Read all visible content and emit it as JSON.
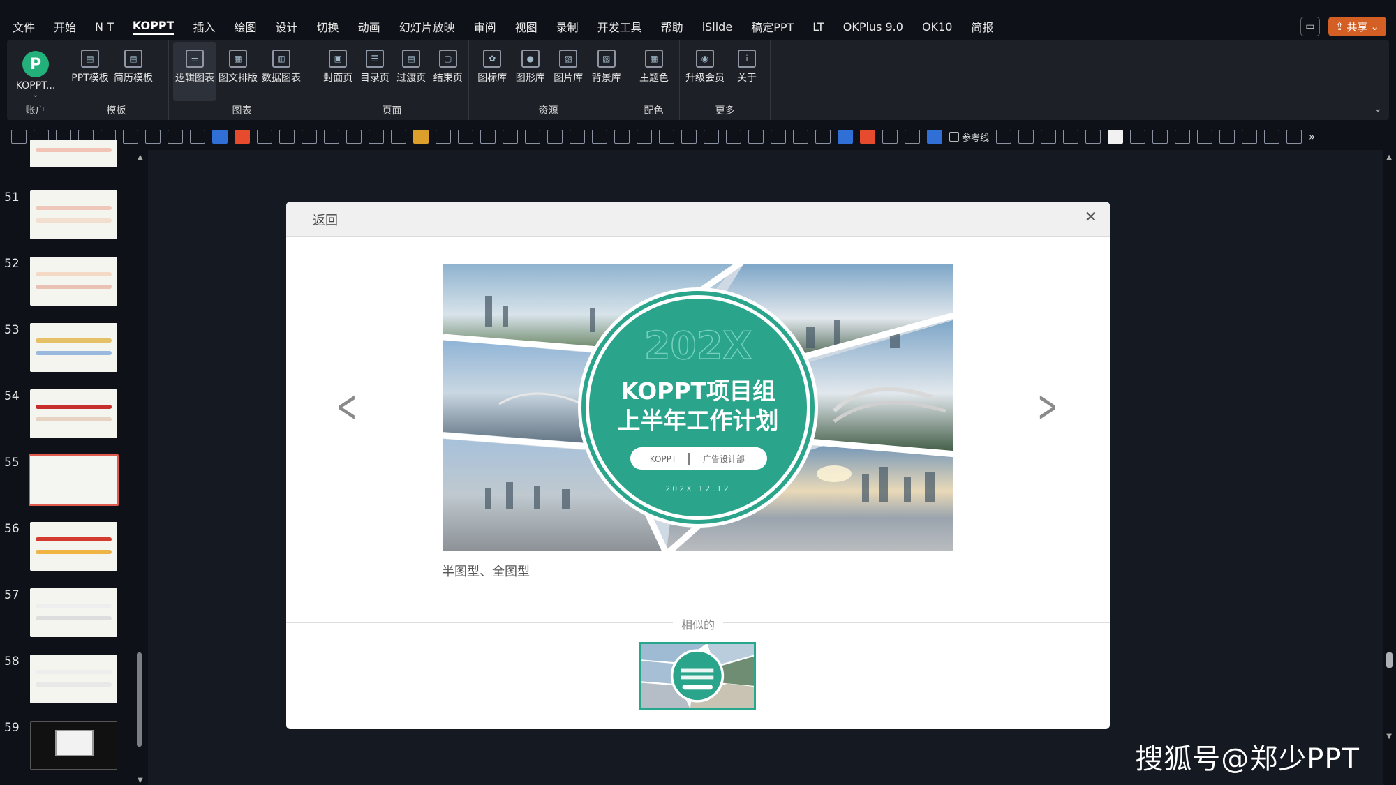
{
  "menu": {
    "items": [
      "文件",
      "开始",
      "N T",
      "KOPPT",
      "插入",
      "绘图",
      "设计",
      "切换",
      "动画",
      "幻灯片放映",
      "审阅",
      "视图",
      "录制",
      "开发工具",
      "帮助",
      "iSlide",
      "稿定PPT",
      "LT",
      "OKPlus 9.0",
      "OK10",
      "简报"
    ],
    "active": "KOPPT",
    "share_label": "共享"
  },
  "ribbon": {
    "account": {
      "button": "KOPPT...",
      "group": "账户"
    },
    "template": {
      "buttons": [
        "PPT模板",
        "简历模板"
      ],
      "group": "模板"
    },
    "chart": {
      "buttons": [
        "逻辑图表",
        "图文排版",
        "数据图表"
      ],
      "group": "图表"
    },
    "page": {
      "buttons": [
        "封面页",
        "目录页",
        "过渡页",
        "结束页"
      ],
      "group": "页面"
    },
    "resource": {
      "buttons": [
        "图标库",
        "图形库",
        "图片库",
        "背景库"
      ],
      "group": "资源"
    },
    "color": {
      "buttons": [
        "主题色"
      ],
      "group": "配色"
    },
    "more": {
      "buttons": [
        "升级会员",
        "关于"
      ],
      "group": "更多"
    }
  },
  "toolbar": {
    "guide_label": "参考线"
  },
  "slides": [
    {
      "num": "51"
    },
    {
      "num": "52"
    },
    {
      "num": "53"
    },
    {
      "num": "54"
    },
    {
      "num": "55",
      "selected": true
    },
    {
      "num": "56"
    },
    {
      "num": "57"
    },
    {
      "num": "58"
    },
    {
      "num": "59"
    }
  ],
  "dialog": {
    "back_label": "返回",
    "close_icon": "close-icon",
    "caption": "半图型、全图型",
    "similar_label": "相似的",
    "cover": {
      "year": "202X",
      "title_line1": "KOPPT项目组",
      "title_line2": "上半年工作计划",
      "pill_left": "KOPPT",
      "pill_right": "广告设计部",
      "date": "202X.12.12",
      "accent_color": "#2aa48a"
    }
  },
  "watermark": "搜狐号@郑少PPT"
}
